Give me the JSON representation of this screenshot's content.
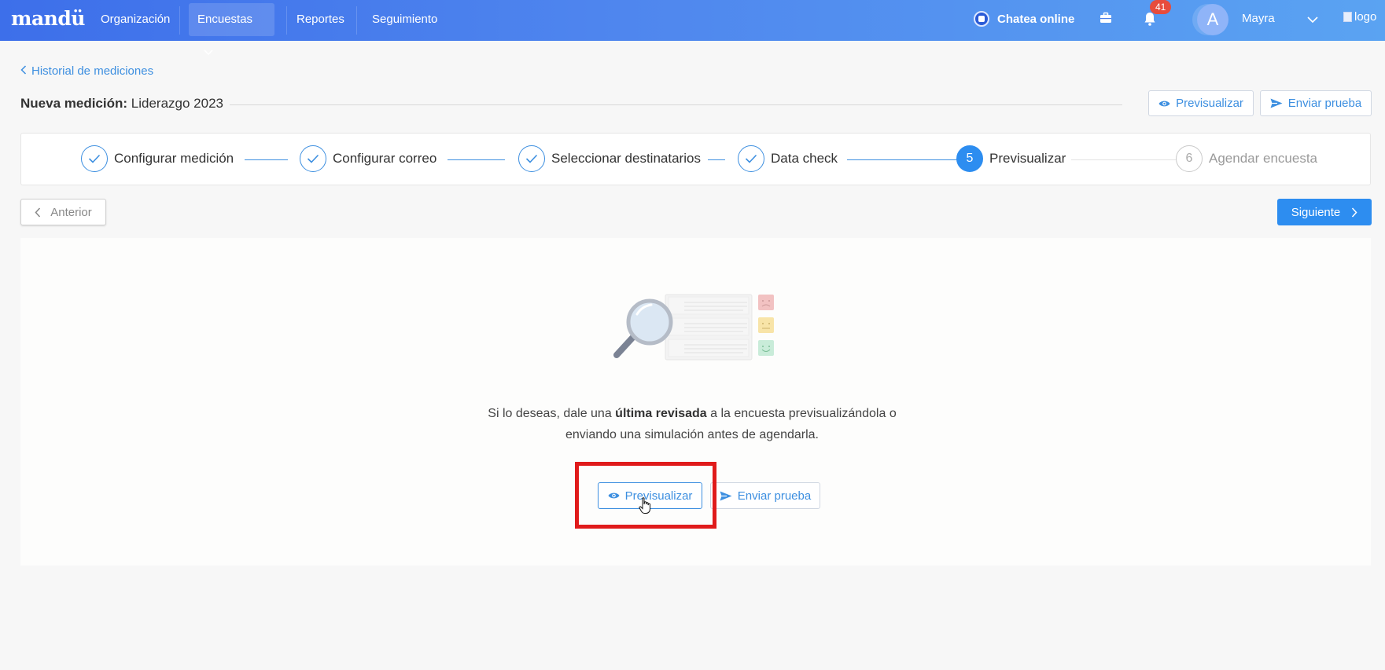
{
  "topbar": {
    "brand": "mandü",
    "nav": [
      {
        "label": "Organización"
      },
      {
        "label": "Encuestas"
      },
      {
        "label": "Reportes"
      },
      {
        "label": "Seguimiento"
      }
    ],
    "chat_label": "Chatea online",
    "notification_count": "41",
    "avatar_initial": "A",
    "username": "Mayra",
    "logo_alt": "logo",
    "gradient_start": "#3d6fea",
    "gradient_end": "#5aa3f2"
  },
  "header": {
    "back_label": "Historial de mediciones",
    "title_prefix": "Nueva medición:",
    "title_value": " Liderazgo 2023",
    "preview_label": "Previsualizar",
    "send_test_label": "Enviar prueba"
  },
  "stepper": {
    "steps": [
      {
        "label": "Configurar medición",
        "state": "done"
      },
      {
        "label": "Configurar correo",
        "state": "done"
      },
      {
        "label": "Seleccionar destinatarios",
        "state": "done"
      },
      {
        "label": "Data check",
        "state": "done"
      },
      {
        "number": "5",
        "label": "Previsualizar",
        "state": "active"
      },
      {
        "number": "6",
        "label": "Agendar encuesta",
        "state": "pending"
      }
    ]
  },
  "navigation": {
    "prev_label": "Anterior",
    "next_label": "Siguiente"
  },
  "content": {
    "message_part1": "Si lo deseas, dale una ",
    "message_bold": "última revisada",
    "message_part2": " a la encuesta previsualizándola o",
    "message_line2": "enviando una simulación antes de agendarla.",
    "preview_label": "Previsualizar",
    "send_test_label": "Enviar prueba"
  },
  "colors": {
    "accent": "#2d8df0",
    "link": "#3d8fe0",
    "highlight": "#e01b1b",
    "badge": "#e74c3c"
  }
}
